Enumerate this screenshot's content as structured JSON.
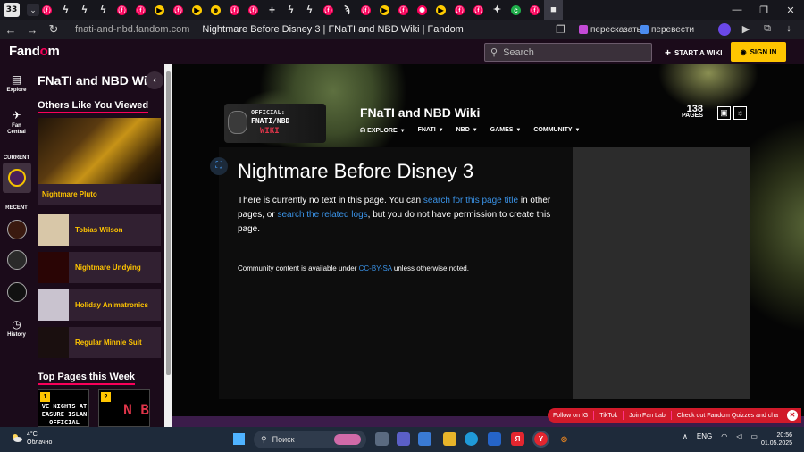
{
  "browser": {
    "tab_count": "33",
    "url": "fnati-and-nbd.fandom.com",
    "page_title": "Nightmare Before Disney 3 | FNaTI and NBD Wiki | Fandom",
    "translate_btn": "пересказать",
    "translate_btn2": "перевести",
    "tab_icons": [
      "fan",
      "bolt",
      "bolt",
      "bolt",
      "fan",
      "fan",
      "yt",
      "fan",
      "yt",
      "mask",
      "fan",
      "fan",
      "plus",
      "bolt",
      "bolt",
      "fan",
      "bolt2",
      "fan",
      "yt",
      "fan",
      "fire",
      "yt",
      "fan",
      "fan",
      "chat",
      "green",
      "fan",
      "active"
    ]
  },
  "fandom": {
    "logo_pre": "Fand",
    "logo_o": "o",
    "logo_post": "m",
    "search_placeholder": "Search",
    "start_wiki": "START A WIKI",
    "sign_in": "SIGN IN"
  },
  "rail": {
    "explore": "Explore",
    "fan_central_1": "Fan",
    "fan_central_2": "Central",
    "current": "CURRENT",
    "recent": "RECENT",
    "history": "History"
  },
  "sidebar": {
    "title": "FNaTI and NBD Wiki",
    "others_heading": "Others Like You Viewed",
    "featured": "Nightmare Pluto",
    "items": [
      {
        "label": "Tobias Wilson",
        "thumb": "#d8c7a8"
      },
      {
        "label": "Nightmare Undying",
        "thumb": "#2a0505"
      },
      {
        "label": "Holiday Animatronics",
        "thumb": "#c9c3cf"
      },
      {
        "label": "Regular Minnie Suit",
        "thumb": "#1a0f0f"
      }
    ],
    "top_heading": "Top Pages this Week",
    "top_pages": [
      {
        "num": "1",
        "text": "VE NIGHTS AT EASURE ISLAN OFFICIAL REMAKE"
      },
      {
        "num": "2",
        "text": "N B"
      }
    ]
  },
  "wiki": {
    "logo_line1": "OFFICIAL:",
    "logo_line2": "FNATI/NBD",
    "logo_line3": "WIKI",
    "name": "FNaTI and NBD Wiki",
    "nav": [
      "EXPLORE",
      "FNATI",
      "NBD",
      "GAMES",
      "COMMUNITY"
    ],
    "pages_count": "138",
    "pages_label": "PAGES"
  },
  "article": {
    "title": "Nightmare Before Disney 3",
    "msg_1": "There is currently no text in this page. You can ",
    "link_1": "search for this page title",
    "msg_2": " in other pages, or ",
    "link_2": "search the related logs",
    "msg_3": ", but you do not have permission to create this page.",
    "license_pre": "Community content is available under ",
    "license_link": "CC-BY-SA",
    "license_post": " unless otherwise noted."
  },
  "actionbar": {
    "ig": "Follow on IG",
    "tiktok": "TikTok",
    "fanlab": "Join Fan Lab",
    "quizzes": "Check out Fandom Quizzes and cha"
  },
  "taskbar": {
    "temp": "4°C",
    "weather": "Облачно",
    "search": "Поиск",
    "lang": "ENG",
    "time": "20:56",
    "date": "01.05.2025"
  }
}
